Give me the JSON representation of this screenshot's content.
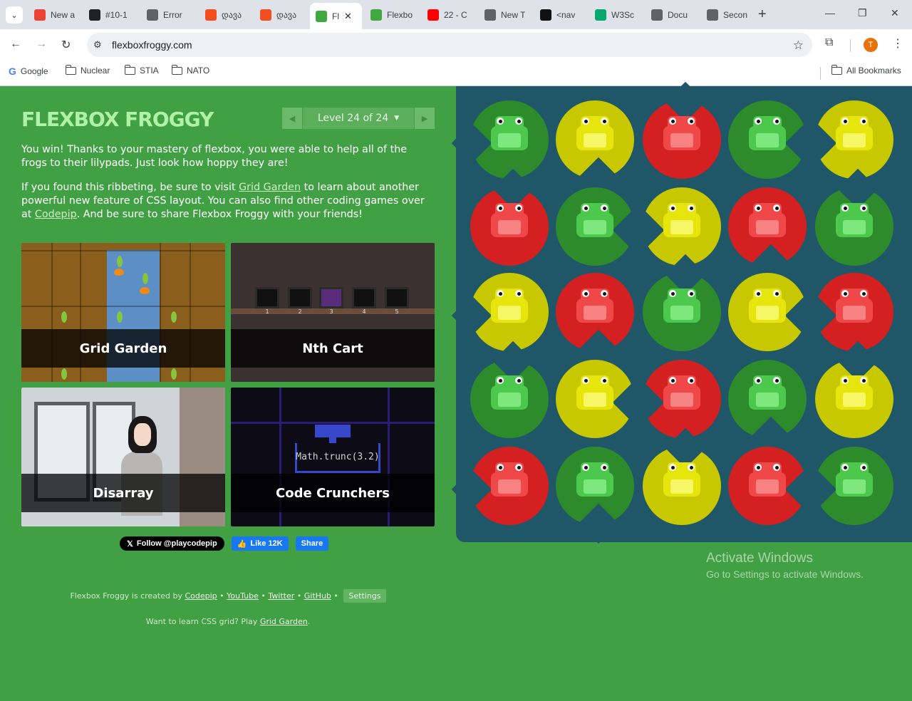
{
  "browser": {
    "tabs": [
      {
        "label": "New a",
        "favicon": "gmail-icon",
        "color": "#ea4335"
      },
      {
        "label": "#10-1",
        "favicon": "contact-card-icon",
        "color": "#202124"
      },
      {
        "label": "Error",
        "favicon": "globe-icon",
        "color": "#5f6368"
      },
      {
        "label": "დავა",
        "favicon": "figma-icon",
        "color": "#f24e1e"
      },
      {
        "label": "დავა",
        "favicon": "figma-icon",
        "color": "#f24e1e"
      },
      {
        "label": "Fl",
        "favicon": "frog-icon",
        "color": "#3fa83f",
        "active": true
      },
      {
        "label": "Flexbo",
        "favicon": "frog-icon",
        "color": "#3fa83f"
      },
      {
        "label": "22 - C",
        "favicon": "youtube-icon",
        "color": "#ff0000"
      },
      {
        "label": "New T",
        "favicon": "globe-icon",
        "color": "#5f6368"
      },
      {
        "label": "<nav",
        "favicon": "devdocs-icon",
        "color": "#111111"
      },
      {
        "label": "W3Sc",
        "favicon": "w3schools-icon",
        "color": "#04aa6d"
      },
      {
        "label": "Docu",
        "favicon": "globe-icon",
        "color": "#5f6368"
      },
      {
        "label": "Secon",
        "favicon": "globe-icon",
        "color": "#5f6368"
      }
    ],
    "url": "flexboxfroggy.com",
    "profile_initial": "T",
    "bookmarks": [
      "Google",
      "Nuclear",
      "STIA",
      "NATO"
    ],
    "all_bookmarks": "All Bookmarks"
  },
  "game": {
    "title": "FLEXBOX FROGGY",
    "level_label": "Level 24 of 24",
    "intro_p1": "You win! Thanks to your mastery of flexbox, you were able to help all of the frogs to their lilypads. Just look how hoppy they are!",
    "intro_p2_a": "If you found this ribbeting, be sure to visit ",
    "intro_p2_link1": "Grid Garden",
    "intro_p2_b": " to learn about another powerful new feature of CSS layout. You can also find other coding games over at ",
    "intro_p2_link2": "Codepip",
    "intro_p2_c": ". And be sure to share Flexbox Froggy with your friends!",
    "games": [
      "Grid Garden",
      "Nth Cart",
      "Disarray",
      "Code Crunchers"
    ],
    "nth_cart_numbers": [
      "1",
      "2",
      "3",
      "4",
      "5"
    ],
    "code_text": "Math.trunc(3.2)",
    "follow_label": "Follow @playcodepip",
    "fb_like": "Like 12K",
    "fb_share": "Share",
    "footer_prefix": "Flexbox Froggy is created by",
    "footer_links": [
      "Codepip",
      "YouTube",
      "Twitter",
      "GitHub"
    ],
    "footer_separator": "•",
    "settings_label": "Settings",
    "footer2_prefix": "Want to learn CSS grid? Play",
    "footer2_link": "Grid Garden",
    "footer2_suffix": ".",
    "board": [
      [
        "green",
        "yellow",
        "red",
        "green",
        "yellow"
      ],
      [
        "red",
        "green",
        "yellow",
        "red",
        "green"
      ],
      [
        "yellow",
        "red",
        "green",
        "yellow",
        "red"
      ],
      [
        "green",
        "yellow",
        "red",
        "green",
        "yellow"
      ],
      [
        "red",
        "green",
        "yellow",
        "red",
        "green"
      ]
    ]
  },
  "watermark": {
    "line1": "Activate Windows",
    "line2": "Go to Settings to activate Windows."
  }
}
